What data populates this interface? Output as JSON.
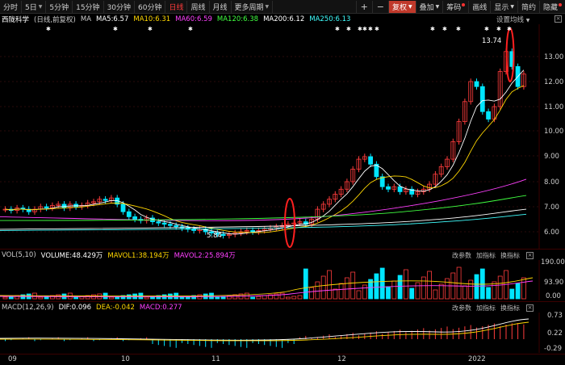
{
  "toolbar": {
    "periods": [
      "分时",
      "5日",
      "5分钟",
      "15分钟",
      "30分钟",
      "60分钟",
      "日线",
      "周线",
      "月线",
      "更多周期"
    ],
    "active_period": "日线",
    "right_buttons": [
      "+",
      "−",
      "复权",
      "叠加",
      "筹码",
      "画线",
      "显示",
      "简约",
      "隐藏"
    ],
    "close_icon": "close-icon"
  },
  "main": {
    "stock_name": "西陇科学",
    "mode": "(日线,前复权)",
    "ma_label": "MA",
    "ma5": "MA5:6.57",
    "ma10": "MA10:6.31",
    "ma60": "MA60:6.59",
    "ma120": "MA120:6.38",
    "ma200": "MA200:6.12",
    "ma250": "MA250:6.13",
    "settings": "设置均线",
    "high_label": "13.74",
    "low_label": "5.84",
    "y_ticks": [
      "13.00",
      "12.00",
      "11.00",
      "10.00",
      "9.00",
      "8.00",
      "7.00",
      "6.00"
    ],
    "colors": {
      "ma5": "#ffffff",
      "ma10": "#ffd700",
      "ma60": "#ff40ff",
      "ma120": "#40ff40",
      "ma200": "#ffffff",
      "ma250": "#40ffff",
      "up": "#ff3c3c",
      "down": "#00e5ff"
    }
  },
  "volume": {
    "title": "VOL(5,10)",
    "volume": "VOLUME:48.429万",
    "mavol1": "MAVOL1:38.194万",
    "mavol2": "MAVOL2:25.894万",
    "buttons": [
      "改参数",
      "加指标",
      "换指标"
    ],
    "y_ticks": [
      "190.00",
      "93.90",
      "0.00"
    ]
  },
  "macd": {
    "title": "MACD(12,26,9)",
    "dif": "DIF:0.096",
    "dea": "DEA:-0.042",
    "macd": "MACD:0.277",
    "buttons": [
      "改参数",
      "加指标",
      "换指标"
    ],
    "y_ticks": [
      "0.73",
      "0.22",
      "-0.29"
    ]
  },
  "x_axis": {
    "labels": [
      "09",
      "10",
      "11",
      "12",
      "2022"
    ]
  }
}
